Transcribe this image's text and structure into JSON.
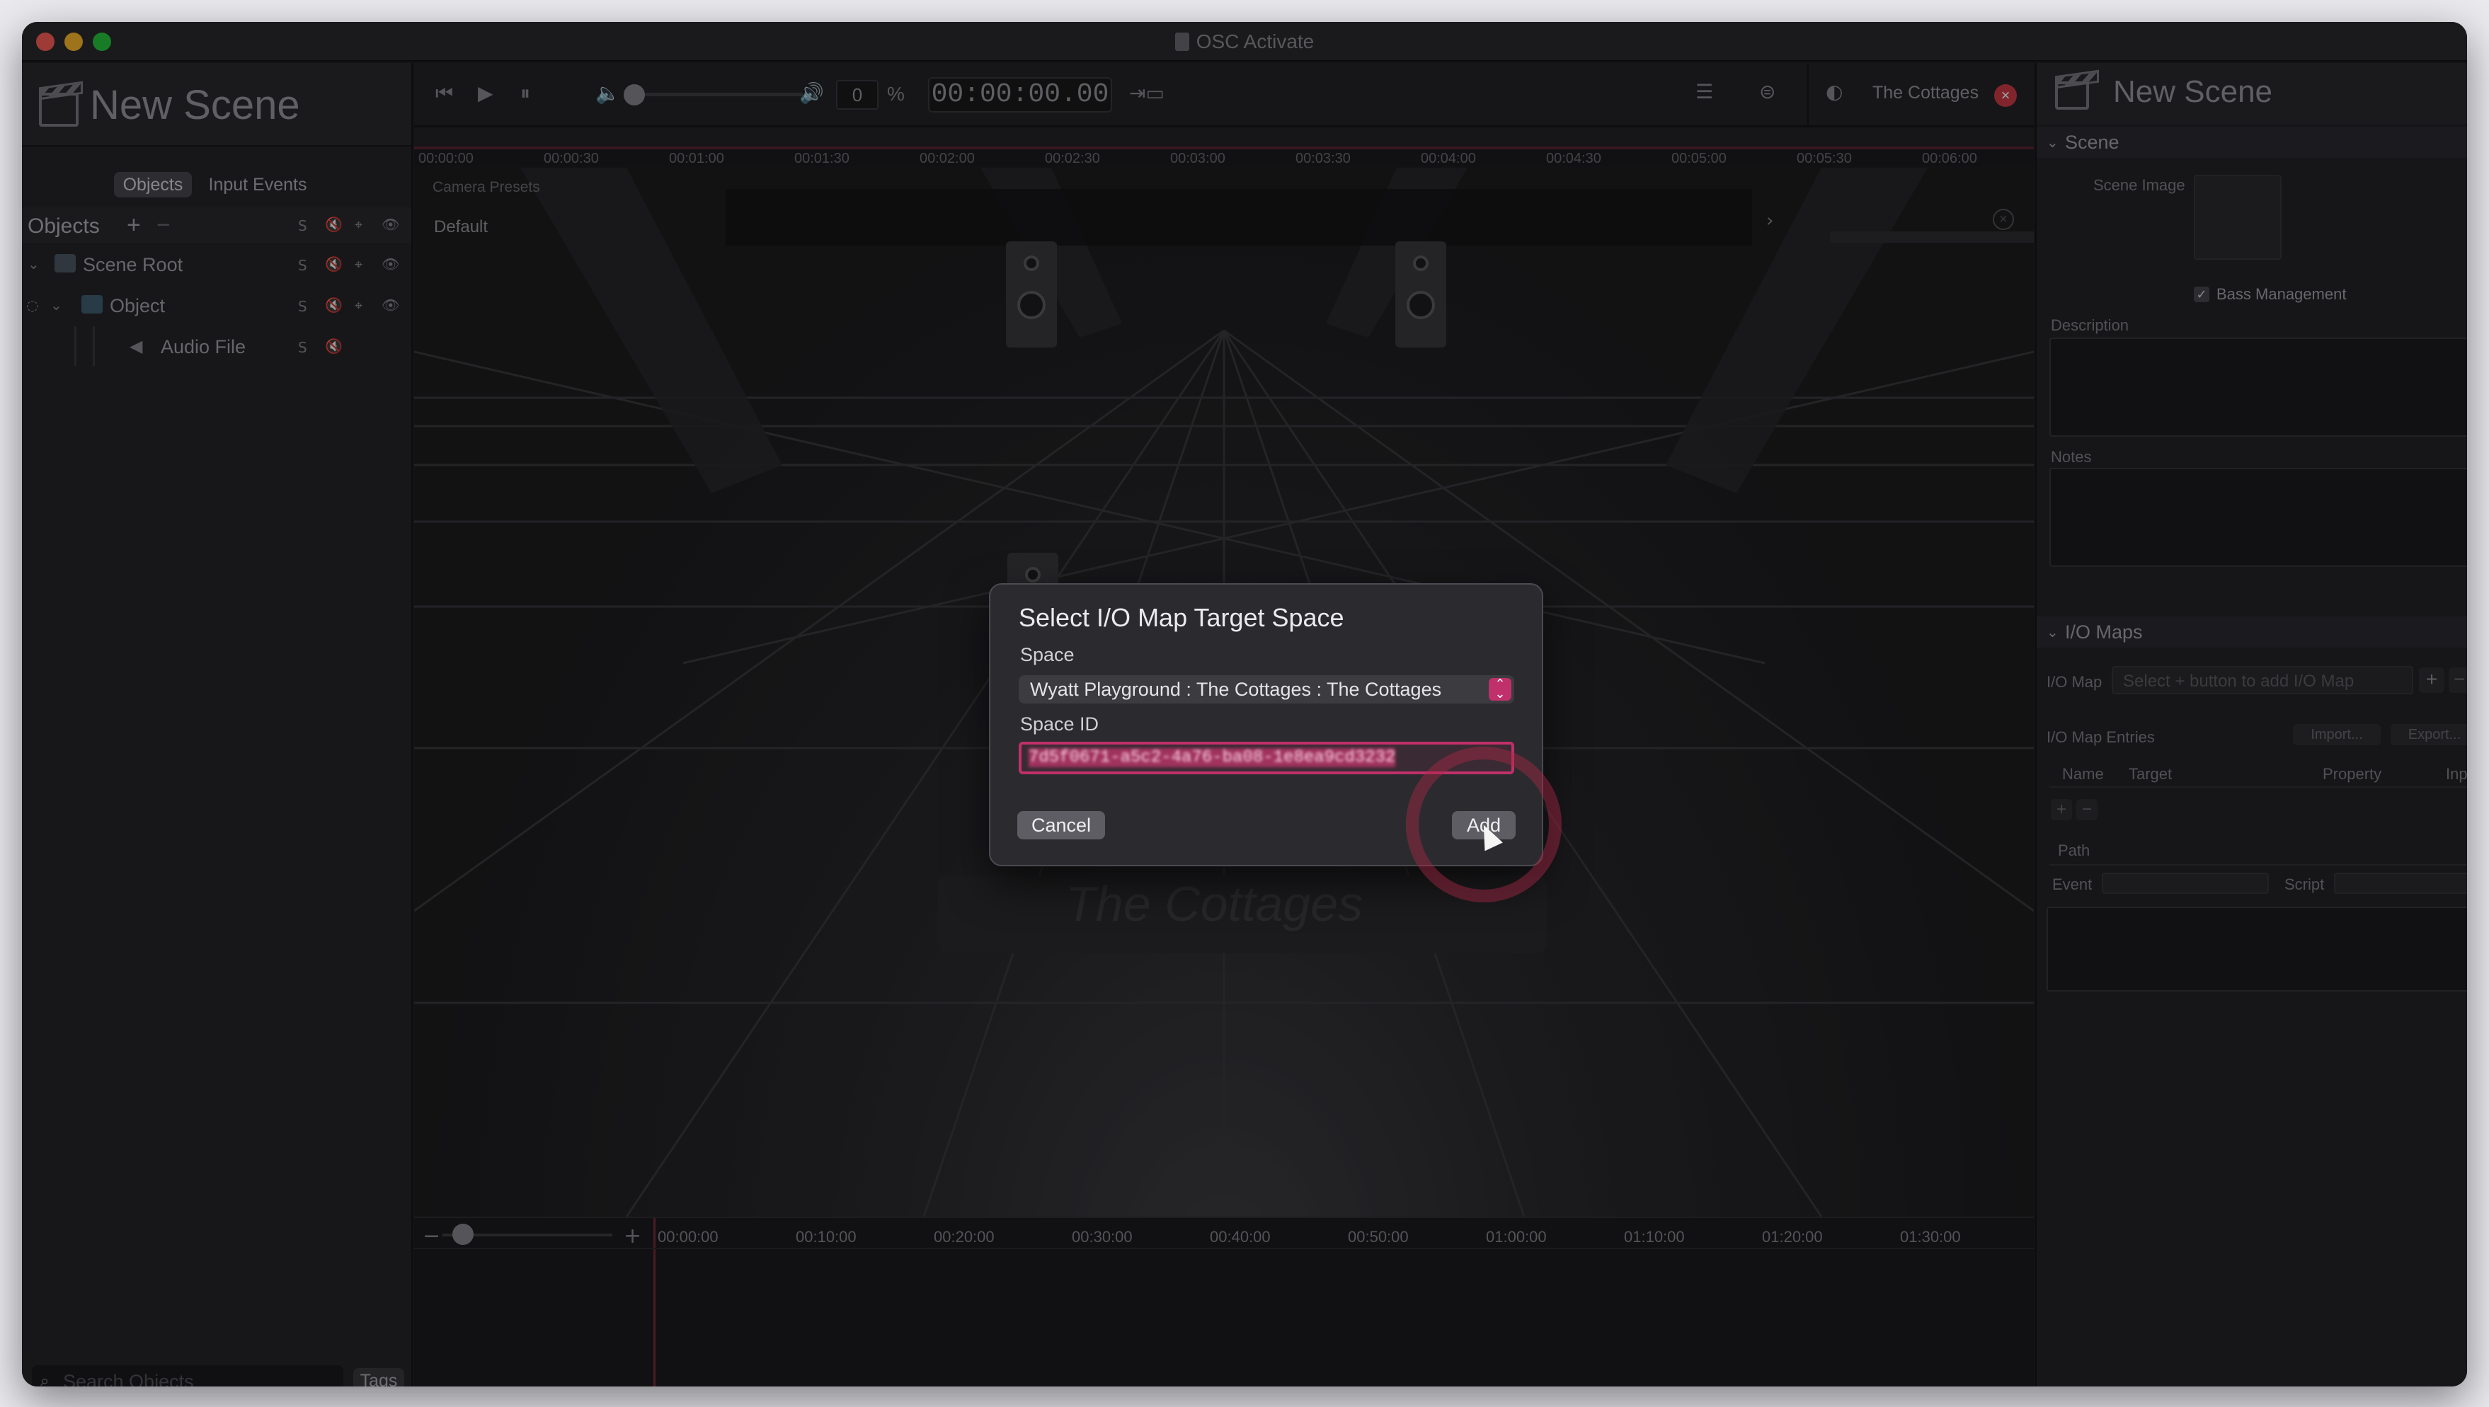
{
  "window": {
    "title": "OSC Activate"
  },
  "left_panel": {
    "title": "New Scene",
    "tabs": [
      "Objects",
      "Input Events"
    ],
    "objects_header": "Objects",
    "add_symbol": "+",
    "remove_symbol": "−",
    "col_s": "S",
    "tree": [
      {
        "label": "Scene Root"
      },
      {
        "label": "Object"
      },
      {
        "label": "Audio File"
      }
    ],
    "search_placeholder": "Search Objects",
    "tags_label": "Tags"
  },
  "toolbar": {
    "volume_value": "0",
    "percent": "%",
    "timecode": "00:00:00.00",
    "space_name": "The Cottages"
  },
  "timeline": {
    "ruler_ticks": [
      "00:00:00",
      "00:00:30",
      "00:01:00",
      "00:01:30",
      "00:02:00",
      "00:02:30",
      "00:03:00",
      "00:03:30",
      "00:04:00",
      "00:04:30",
      "00:05:00",
      "00:05:30",
      "00:06:00"
    ],
    "camera_presets_label": "Camera Presets",
    "preset_default": "Default",
    "bottom_ticks": [
      "00:00:00",
      "00:10:00",
      "00:20:00",
      "00:30:00",
      "00:40:00",
      "00:50:00",
      "01:00:00",
      "01:10:00",
      "01:20:00",
      "01:30:00"
    ],
    "zoom_minus": "−",
    "zoom_plus": "+",
    "watermark": "The Cottages"
  },
  "right_panel": {
    "title": "New Scene",
    "scene_section": "Scene",
    "scene_image_label": "Scene Image",
    "bass_management_label": "Bass Management",
    "description_label": "Description",
    "notes_label": "Notes",
    "io_maps_section": "I/O Maps",
    "io_map_label": "I/O Map",
    "io_map_placeholder": "Select + button to add I/O Map",
    "io_map_entries_label": "I/O Map Entries",
    "import_label": "Import...",
    "export_label": "Export...",
    "col_name": "Name",
    "col_target": "Target",
    "col_property": "Property",
    "col_input": "Inpu",
    "path_label": "Path",
    "event_label": "Event",
    "script_label": "Script"
  },
  "dialog": {
    "title": "Select I/O Map Target Space",
    "space_label": "Space",
    "space_value": "Wyatt Playground : The Cottages : The Cottages",
    "space_id_label": "Space ID",
    "space_id_value": "7d5f0671-a5c2-4a76-ba08-1e8ea9cd3232",
    "cancel_label": "Cancel",
    "add_label": "Add"
  },
  "colors": {
    "accent": "#c0306a",
    "close_red": "#ff5f57",
    "minimize_yellow": "#febc2e",
    "zoom_green": "#28c840",
    "badge_red": "#d13c4a"
  }
}
